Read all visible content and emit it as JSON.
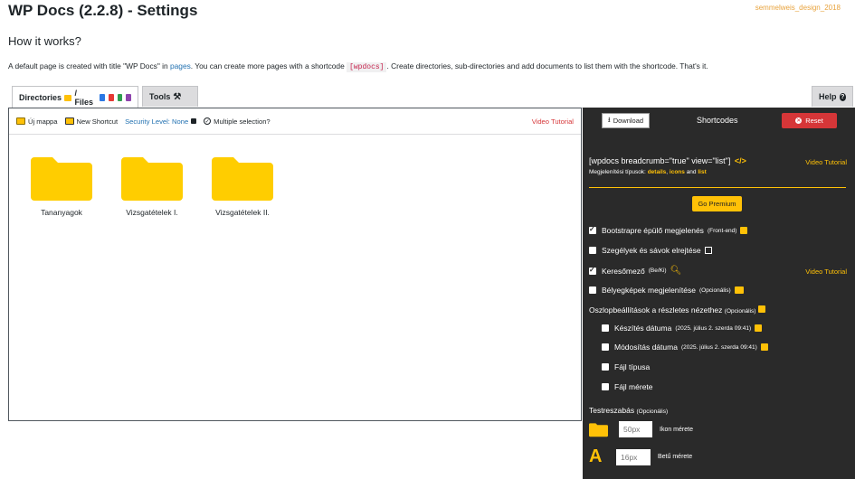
{
  "header": {
    "title": "WP Docs (2.2.8) - Settings",
    "brand": "semmelweis_design_2018",
    "subtitle": "How it works?",
    "intro_before": "A default page is created with title \"WP Docs\" in ",
    "intro_link": "pages",
    "intro_middle": ". You can create more pages with a shortcode ",
    "intro_code": "[wpdocs]",
    "intro_after": ". Create directories, sub-directories and add documents to list them with the shortcode. That's it."
  },
  "tabs": {
    "directories_label": "Directories",
    "files_label": " / Files",
    "tools_label": "Tools",
    "help_label": "Help"
  },
  "toolbar": {
    "new_folder": "Új mappa",
    "new_shortcut": "New Shortcut",
    "security": "Security Level: None",
    "multiple": "Multiple selection?",
    "video": "Video Tutorial"
  },
  "folders": [
    {
      "name": "Tananyagok"
    },
    {
      "name": "Vizsgatételek I."
    },
    {
      "name": "Vizsgatételek II."
    }
  ],
  "panel": {
    "download": "Download",
    "title": "Shortcodes",
    "reset": "Reset",
    "shortcode": "[wpdocs breadcrumb=\"true\" view=\"list\"]",
    "video1": "Video Tutorial",
    "types_label": "Megjelenítési típusok:",
    "type1": "details",
    "type2": "icons",
    "type_and": " and ",
    "type3": "list",
    "premium": "Go Premium",
    "options": [
      {
        "label": "Bootstrapre épülő megjelenés",
        "note": "(Front-end)",
        "checked": true
      },
      {
        "label": "Szegélyek és sávok elrejtése",
        "note": "",
        "checked": false
      },
      {
        "label": "Keresőmező",
        "note": "(Be/Ki)",
        "checked": true
      },
      {
        "label": "Bélyegképek megjelenítése",
        "note": "(Opcionális)",
        "checked": false
      }
    ],
    "video2": "Video Tutorial",
    "columns_label": "Oszlopbeállítások a részletes nézethez",
    "columns_note": "(Opcionális)",
    "columns": [
      {
        "label": "Készítés dátuma",
        "note": "(2025. július 2. szerda 09:41)"
      },
      {
        "label": "Módosítás dátuma",
        "note": "(2025. július 2. szerda 09:41)"
      },
      {
        "label": "Fájl típusa",
        "note": ""
      },
      {
        "label": "Fájl mérete",
        "note": ""
      }
    ],
    "custom_label": "Testreszabás",
    "custom_note": "(Opcionális)",
    "icon_size": "50px",
    "icon_size_label": "Ikon mérete",
    "font_size": "16px",
    "font_size_label": "Betű mérete"
  },
  "colors": {
    "accent": "#ffc107",
    "panel_bg": "#2a2a2a",
    "danger": "#d63638",
    "link": "#2271b1"
  }
}
